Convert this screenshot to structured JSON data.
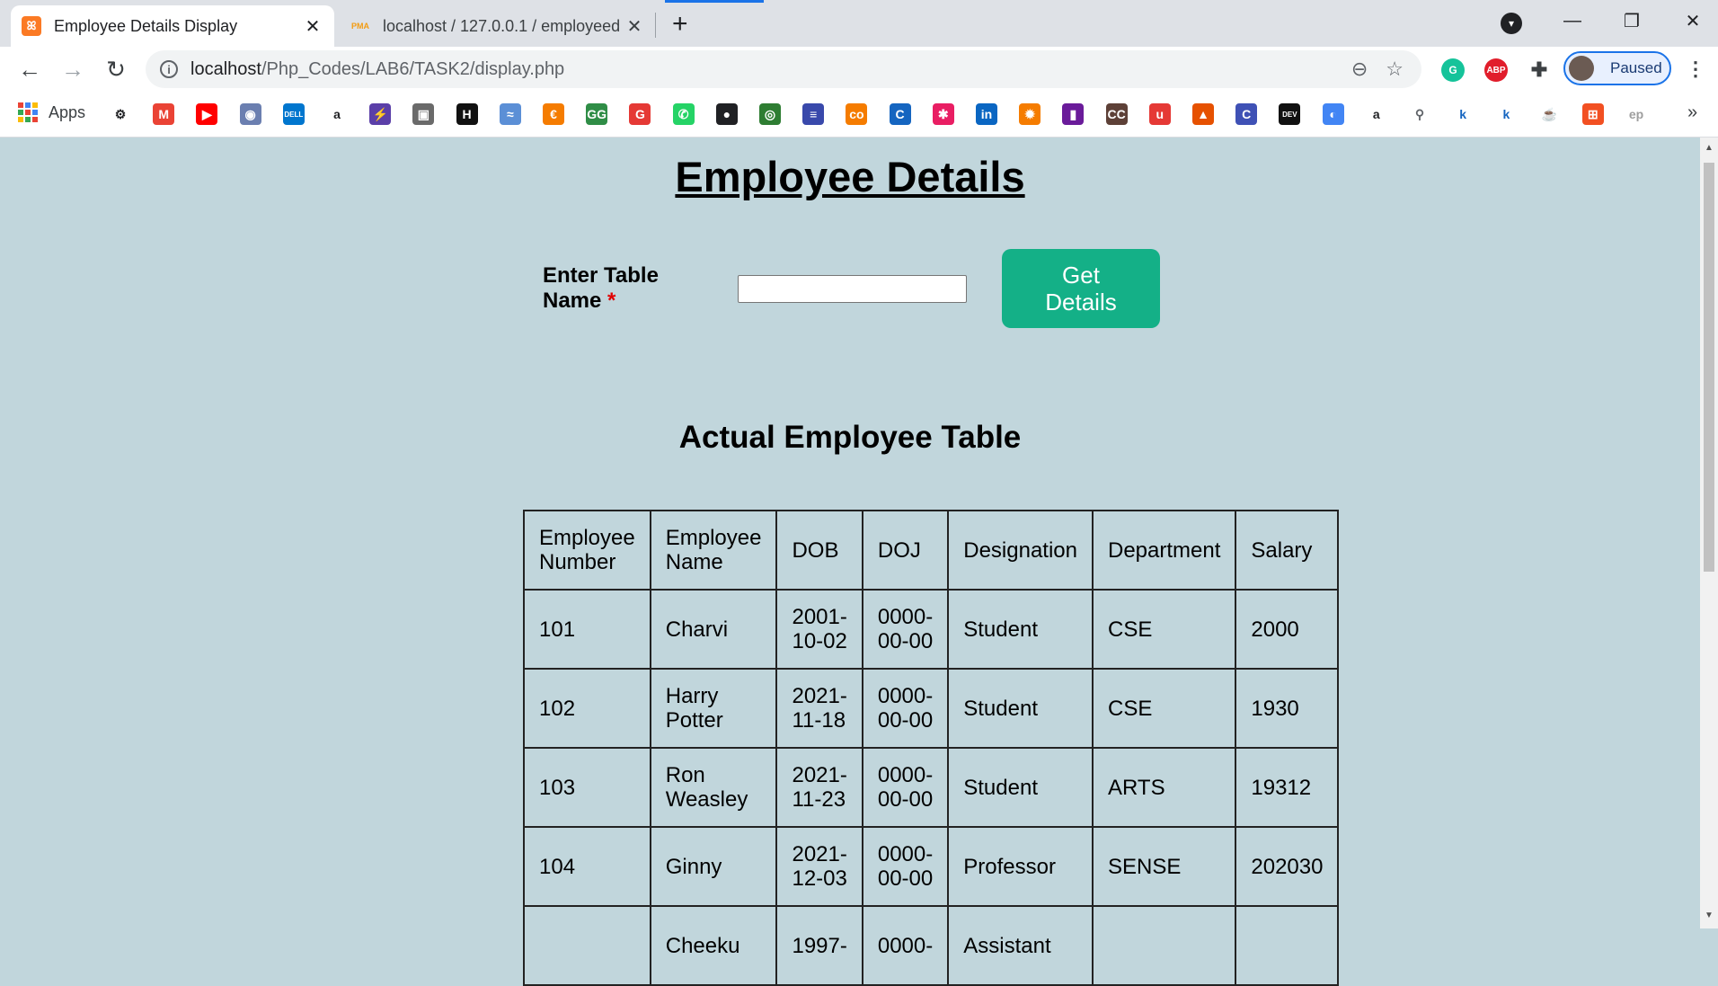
{
  "browser": {
    "tabs": [
      {
        "title": "Employee Details Display",
        "favicon": "xampp-icon",
        "active": true
      },
      {
        "title": "localhost / 127.0.0.1 / employeed",
        "favicon": "phpmyadmin-icon",
        "favicon_text": "PMA",
        "active": false
      }
    ],
    "url_host": "localhost",
    "url_path": "/Php_Codes/LAB6/TASK2/display.php",
    "profile_label": "Paused",
    "bookmarks_apps_label": "Apps",
    "bookmarks": [
      {
        "icon": "settings-icon",
        "text": "⚙",
        "color": "#202124"
      },
      {
        "icon": "gmail-icon",
        "text": "M",
        "color": "#ea4335"
      },
      {
        "icon": "youtube-icon",
        "text": "▶",
        "color": "#ff0000"
      },
      {
        "icon": "bookmark-icon",
        "text": "◉",
        "color": "#6b7fb0"
      },
      {
        "icon": "dell-icon",
        "text": "DELL",
        "color": "#0076ce"
      },
      {
        "icon": "amazon-icon",
        "text": "a",
        "color": "#202124"
      },
      {
        "icon": "bolt-icon",
        "text": "⚡",
        "color": "#5b3fa8"
      },
      {
        "icon": "image-icon",
        "text": "▣",
        "color": "#6a6a6a"
      },
      {
        "icon": "hackerrank-icon",
        "text": "H",
        "color": "#111111"
      },
      {
        "icon": "wave-icon",
        "text": "≈",
        "color": "#5b8fd6"
      },
      {
        "icon": "codechef-icon",
        "text": "€",
        "color": "#f57c00"
      },
      {
        "icon": "geeksforgeeks-icon",
        "text": "GG",
        "color": "#2f8d46"
      },
      {
        "icon": "grammarly-icon",
        "text": "G",
        "color": "#e53935"
      },
      {
        "icon": "whatsapp-icon",
        "text": "✆",
        "color": "#25d366"
      },
      {
        "icon": "github-icon",
        "text": "●",
        "color": "#202124"
      },
      {
        "icon": "codewars-icon",
        "text": "◎",
        "color": "#2e7d32"
      },
      {
        "icon": "stack-icon",
        "text": "≡",
        "color": "#3949ab"
      },
      {
        "icon": "coursera-icon",
        "text": "co",
        "color": "#f57c00"
      },
      {
        "icon": "c-icon",
        "text": "C",
        "color": "#1565c0"
      },
      {
        "icon": "star-icon",
        "text": "✱",
        "color": "#e91e63"
      },
      {
        "icon": "linkedin-icon",
        "text": "in",
        "color": "#0a66c2"
      },
      {
        "icon": "gear-sun-icon",
        "text": "✹",
        "color": "#f57c00"
      },
      {
        "icon": "chart-icon",
        "text": "▮",
        "color": "#6a1b9a"
      },
      {
        "icon": "cc-icon",
        "text": "CC",
        "color": "#5d4037"
      },
      {
        "icon": "udemy-icon",
        "text": "u",
        "color": "#e53935"
      },
      {
        "icon": "matlab-icon",
        "text": "▲",
        "color": "#e65100"
      },
      {
        "icon": "circle-c-icon",
        "text": "C",
        "color": "#3f51b5"
      },
      {
        "icon": "dev-icon",
        "text": "DEV",
        "color": "#111111"
      },
      {
        "icon": "chrome-web-icon",
        "text": "◐",
        "color": "#4285f4"
      },
      {
        "icon": "amazon2-icon",
        "text": "a",
        "color": "#202124"
      },
      {
        "icon": "search-glass-icon",
        "text": "⚲",
        "color": "#5f6368"
      },
      {
        "icon": "k-icon",
        "text": "k",
        "color": "#1565c0"
      },
      {
        "icon": "kt-icon",
        "text": "k",
        "color": "#1565c0"
      },
      {
        "icon": "coffee-icon",
        "text": "☕",
        "color": "#202124"
      },
      {
        "icon": "microsoft-icon",
        "text": "⊞",
        "color": "#f25022"
      },
      {
        "icon": "ep-icon",
        "text": "ep",
        "color": "#9e9e9e"
      }
    ]
  },
  "page": {
    "title": "Employee Details",
    "form": {
      "label_line1": "Enter Table",
      "label_line2": "Name",
      "required_mark": "*",
      "input_value": "",
      "button_line1": "Get",
      "button_line2": "Details"
    },
    "table_title": "Actual Employee Table",
    "table": {
      "headers": [
        [
          "Employee",
          "Number"
        ],
        [
          "Employee",
          "Name"
        ],
        [
          "DOB"
        ],
        [
          "DOJ"
        ],
        [
          "Designation"
        ],
        [
          "Department"
        ],
        [
          "Salary"
        ]
      ],
      "rows": [
        {
          "number": "101",
          "name": [
            "Charvi"
          ],
          "dob": [
            "2001-",
            "10-02"
          ],
          "doj": [
            "0000-",
            "00-00"
          ],
          "designation": "Student",
          "department": "CSE",
          "salary": "2000"
        },
        {
          "number": "102",
          "name": [
            "Harry",
            "Potter"
          ],
          "dob": [
            "2021-",
            "11-18"
          ],
          "doj": [
            "0000-",
            "00-00"
          ],
          "designation": "Student",
          "department": "CSE",
          "salary": "1930"
        },
        {
          "number": "103",
          "name": [
            "Ron",
            "Weasley"
          ],
          "dob": [
            "2021-",
            "11-23"
          ],
          "doj": [
            "0000-",
            "00-00"
          ],
          "designation": "Student",
          "department": "ARTS",
          "salary": "19312"
        },
        {
          "number": "104",
          "name": [
            "Ginny"
          ],
          "dob": [
            "2021-",
            "12-03"
          ],
          "doj": [
            "0000-",
            "00-00"
          ],
          "designation": "Professor",
          "department": "SENSE",
          "salary": "202030"
        },
        {
          "number": "",
          "name": [
            "Cheeku"
          ],
          "dob": [
            "1997-"
          ],
          "doj": [
            "0000-"
          ],
          "designation": "Assistant",
          "department": "",
          "salary": ""
        }
      ]
    },
    "colors": {
      "background": "#c1d6dc",
      "button": "#14b087",
      "required": "#e00000"
    }
  }
}
